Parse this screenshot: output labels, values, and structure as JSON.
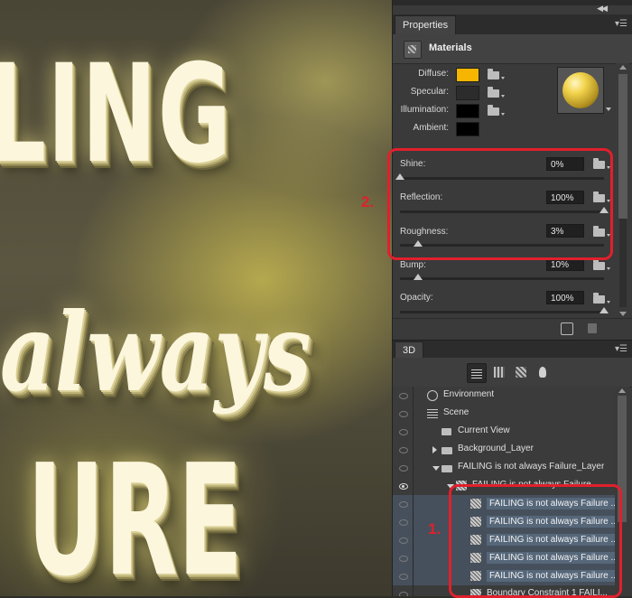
{
  "canvas": {
    "line1": "LING",
    "line2": "always",
    "line3": "URE"
  },
  "properties_panel": {
    "tab_label": "Properties",
    "section_title": "Materials",
    "colors": [
      {
        "label": "Diffuse:",
        "color": "#f5b500"
      },
      {
        "label": "Specular:",
        "color": "#2c2c2c"
      },
      {
        "label": "Illumination:",
        "color": "#000000"
      },
      {
        "label": "Ambient:",
        "color": "#000000"
      }
    ],
    "sliders": [
      {
        "label": "Shine:",
        "value": "0%",
        "level": 0.0
      },
      {
        "label": "Reflection:",
        "value": "100%",
        "level": 1.0
      },
      {
        "label": "Roughness:",
        "value": "3%",
        "level": 0.09
      },
      {
        "label": "Bump:",
        "value": "10%",
        "level": 0.09
      },
      {
        "label": "Opacity:",
        "value": "100%",
        "level": 1.0
      }
    ]
  },
  "annotations": {
    "callout_2": "2.",
    "callout_1": "1."
  },
  "d3_panel": {
    "tab_label": "3D",
    "layers": [
      {
        "name": "Environment",
        "indent": 0,
        "toggle": "",
        "icon": "environment-icon",
        "selected": false,
        "eye": false,
        "highlight": false
      },
      {
        "name": "Scene",
        "indent": 0,
        "toggle": "",
        "icon": "scene-icon",
        "selected": false,
        "eye": false,
        "highlight": false
      },
      {
        "name": "Current View",
        "indent": 1,
        "toggle": "",
        "icon": "camera-icon",
        "selected": false,
        "eye": false,
        "highlight": false
      },
      {
        "name": "Background_Layer",
        "indent": 1,
        "toggle": "right",
        "icon": "folder-icon",
        "selected": false,
        "eye": false,
        "highlight": false
      },
      {
        "name": "FAILING is not always Failure_Layer",
        "indent": 1,
        "toggle": "down",
        "icon": "folder-icon",
        "selected": false,
        "eye": false,
        "highlight": false
      },
      {
        "name": "FAILING is not always Failure",
        "indent": 2,
        "toggle": "down",
        "icon": "mesh-icon",
        "selected": false,
        "eye": true,
        "highlight": false
      },
      {
        "name": "FAILING is not always Failure ...",
        "indent": 3,
        "toggle": "",
        "icon": "material-icon",
        "selected": true,
        "eye": false,
        "highlight": true
      },
      {
        "name": "FAILING is not always Failure ...",
        "indent": 3,
        "toggle": "",
        "icon": "material-icon",
        "selected": true,
        "eye": false,
        "highlight": true
      },
      {
        "name": "FAILING is not always Failure ...",
        "indent": 3,
        "toggle": "",
        "icon": "material-icon",
        "selected": true,
        "eye": false,
        "highlight": true
      },
      {
        "name": "FAILING is not always Failure ...",
        "indent": 3,
        "toggle": "",
        "icon": "material-icon",
        "selected": true,
        "eye": false,
        "highlight": true
      },
      {
        "name": "FAILING is not always Failure ...",
        "indent": 3,
        "toggle": "",
        "icon": "material-icon",
        "selected": true,
        "eye": false,
        "highlight": true
      },
      {
        "name": "Boundary Constraint 1 FAILI...",
        "indent": 3,
        "toggle": "",
        "icon": "constraint-icon",
        "selected": false,
        "eye": false,
        "highlight": false
      }
    ]
  }
}
